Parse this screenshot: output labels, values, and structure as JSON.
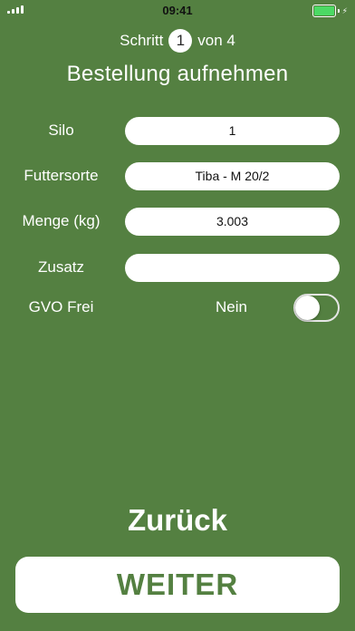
{
  "status_bar": {
    "time": "09:41"
  },
  "step": {
    "prefix": "Schritt",
    "current": "1",
    "suffix": "von 4"
  },
  "title": "Bestellung aufnehmen",
  "form": {
    "silo": {
      "label": "Silo",
      "value": "1"
    },
    "futtersorte": {
      "label": "Futtersorte",
      "value": "Tiba - M 20/2"
    },
    "menge": {
      "label": "Menge (kg)",
      "value": "3.003"
    },
    "zusatz": {
      "label": "Zusatz",
      "value": ""
    },
    "gvo": {
      "label": "GVO Frei",
      "value_text": "Nein",
      "on": false
    }
  },
  "buttons": {
    "back_label": "Zurück",
    "next_label": "WEITER"
  },
  "colors": {
    "background": "#548041",
    "battery": "#4cd964"
  }
}
